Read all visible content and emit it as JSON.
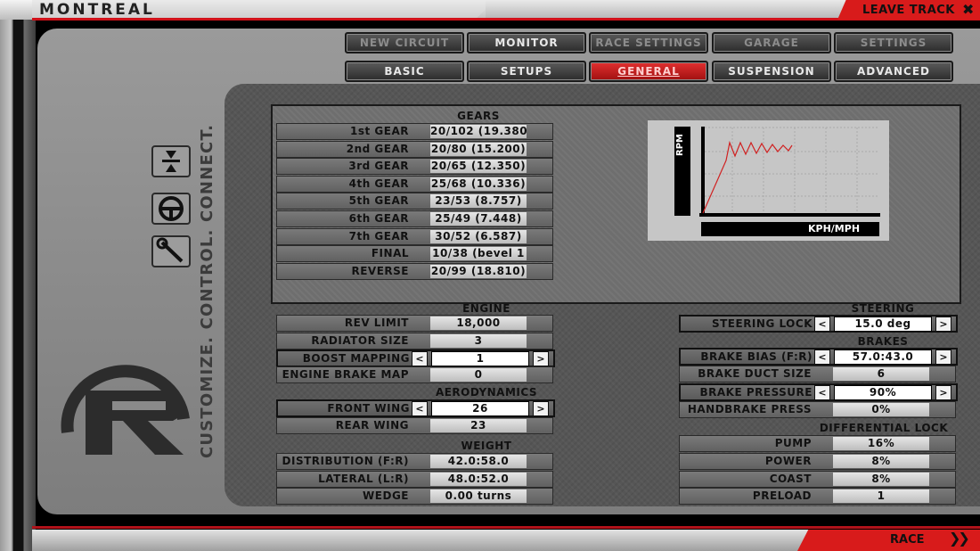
{
  "header": {
    "venue": "MONTREAL",
    "leave_label": "LEAVE TRACK",
    "leave_icon": "close-icon"
  },
  "footer": {
    "race_label": "RACE",
    "race_icon": "double-chevron-right-icon"
  },
  "main_tabs": [
    {
      "label": "NEW CIRCUIT",
      "state": "dim"
    },
    {
      "label": "MONITOR",
      "state": "normal"
    },
    {
      "label": "RACE SETTINGS",
      "state": "dim"
    },
    {
      "label": "GARAGE",
      "state": "dim"
    },
    {
      "label": "SETTINGS",
      "state": "dim"
    }
  ],
  "sub_tabs": [
    {
      "label": "BASIC",
      "state": "normal"
    },
    {
      "label": "SETUPS",
      "state": "normal"
    },
    {
      "label": "GENERAL",
      "state": "active"
    },
    {
      "label": "SUSPENSION",
      "state": "normal"
    },
    {
      "label": "ADVANCED",
      "state": "normal"
    }
  ],
  "sidebar": {
    "slogan": "CUSTOMIZE. CONTROL. CONNECT.",
    "icons": [
      "compress-arrows-icon",
      "steering-wheel-icon",
      "wrench-icon"
    ]
  },
  "gears": {
    "title": "GEARS",
    "rows": [
      {
        "label": "1st GEAR",
        "value": "20/102 (19.380"
      },
      {
        "label": "2nd GEAR",
        "value": "20/80 (15.200)"
      },
      {
        "label": "3rd GEAR",
        "value": "20/65 (12.350)"
      },
      {
        "label": "4th GEAR",
        "value": "25/68 (10.336)"
      },
      {
        "label": "5th GEAR",
        "value": "23/53 (8.757)"
      },
      {
        "label": "6th GEAR",
        "value": "25/49 (7.448)"
      },
      {
        "label": "7th GEAR",
        "value": "30/52 (6.587)"
      },
      {
        "label": "FINAL",
        "value": "10/38 (bevel 1"
      },
      {
        "label": "REVERSE",
        "value": "20/99 (18.810)"
      }
    ]
  },
  "graph": {
    "ylabel": "RPM",
    "xlabel": "KPH/MPH"
  },
  "engine": {
    "title": "ENGINE",
    "rows": [
      {
        "label": "REV LIMIT",
        "value": "18,000"
      },
      {
        "label": "RADIATOR SIZE",
        "value": "3"
      },
      {
        "label": "BOOST MAPPING",
        "value": "1"
      },
      {
        "label": "ENGINE BRAKE MAP",
        "value": "0"
      }
    ]
  },
  "aero": {
    "title": "AERODYNAMICS",
    "rows": [
      {
        "label": "FRONT WING",
        "value": "26"
      },
      {
        "label": "REAR WING",
        "value": "23"
      }
    ]
  },
  "weight": {
    "title": "WEIGHT",
    "rows": [
      {
        "label": "DISTRIBUTION (F:R)",
        "value": "42.0:58.0"
      },
      {
        "label": "LATERAL (L:R)",
        "value": "48.0:52.0"
      },
      {
        "label": "WEDGE",
        "value": "0.00 turns"
      }
    ]
  },
  "steering": {
    "title": "STEERING",
    "rows": [
      {
        "label": "STEERING LOCK",
        "value": "15.0 deg"
      }
    ]
  },
  "brakes": {
    "title": "BRAKES",
    "rows": [
      {
        "label": "BRAKE BIAS (F:R)",
        "value": "57.0:43.0"
      },
      {
        "label": "BRAKE DUCT SIZE",
        "value": "6"
      },
      {
        "label": "BRAKE PRESSURE",
        "value": "90%"
      },
      {
        "label": "HANDBRAKE PRESS",
        "value": "0%"
      }
    ]
  },
  "diff": {
    "title": "DIFFERENTIAL LOCK",
    "rows": [
      {
        "label": "PUMP",
        "value": "16%"
      },
      {
        "label": "POWER",
        "value": "8%"
      },
      {
        "label": "COAST",
        "value": "8%"
      },
      {
        "label": "PRELOAD",
        "value": "1"
      }
    ]
  },
  "arrows": {
    "left": "<",
    "right": ">"
  }
}
